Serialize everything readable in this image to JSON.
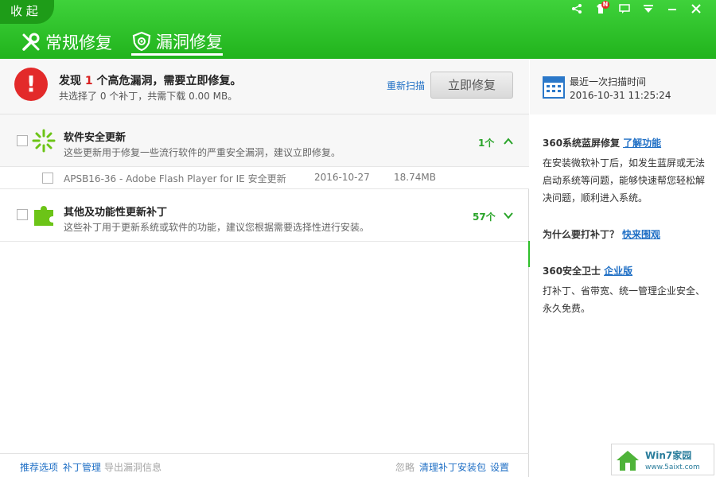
{
  "header": {
    "collapse_label": "收 起",
    "tabs": [
      {
        "label": "常规修复",
        "icon": "tools-icon"
      },
      {
        "label": "漏洞修复",
        "icon": "shield-eye-icon"
      }
    ],
    "badge": "N",
    "accent_color": "#2cc126"
  },
  "alert": {
    "title_prefix": "发现 ",
    "title_count": "1",
    "title_suffix": " 个高危漏洞，需要立即修复。",
    "subtitle": "共选择了 0 个补丁，共需下载 0.00 MB。",
    "rescan_label": "重新扫描",
    "repair_label": "立即修复"
  },
  "groups": [
    {
      "title": "软件安全更新",
      "desc": "这些更新用于修复一些流行软件的严重安全漏洞，建议立即修复。",
      "count": "1个",
      "items": [
        {
          "name": "APSB16-36 - Adobe Flash Player for IE 安全更新",
          "date": "2016-10-27",
          "size": "18.74MB"
        }
      ]
    },
    {
      "title": "其他及功能性更新补丁",
      "desc": "这些补丁用于更新系统或软件的功能，建议您根据需要选择性进行安装。",
      "count": "57个"
    }
  ],
  "footer": {
    "left_links": [
      "推荐选项",
      "补丁管理",
      "导出漏洞信息"
    ],
    "right_links": [
      "忽略",
      "清理补丁安装包",
      "设置"
    ]
  },
  "side": {
    "scan_label": "最近一次扫描时间",
    "scan_time": "2016-10-31 11:25:24",
    "blocks": [
      {
        "title": "360系统蓝屏修复",
        "link": "了解功能",
        "text": "在安装微软补丁后，如发生蓝屏或无法启动系统等问题，能够快速帮您轻松解决问题，顺利进入系统。"
      },
      {
        "title": "为什么要打补丁？",
        "link": "快来围观",
        "text": ""
      },
      {
        "title": "360安全卫士",
        "link": "企业版",
        "text": "打补丁、省带宽、统一管理企业安全、永久免费。"
      }
    ]
  },
  "watermark": {
    "title": "Win7家园",
    "url": "www.5aixt.com"
  }
}
